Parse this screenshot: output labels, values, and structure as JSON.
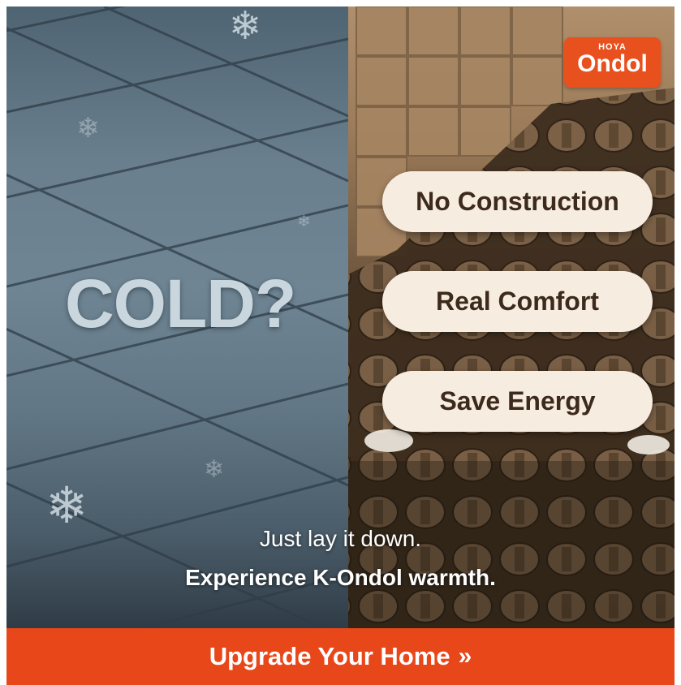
{
  "left_panel": {
    "headline": "COLD?"
  },
  "logo": {
    "small": "HOYA",
    "big": "Ondol"
  },
  "features": [
    {
      "label": "No Construction"
    },
    {
      "label": "Real Comfort"
    },
    {
      "label": "Save Energy"
    }
  ],
  "tagline": {
    "line1": "Just lay it down.",
    "line2": "Experience K-Ondol warmth."
  },
  "cta": {
    "label": "Upgrade Your Home",
    "arrow": "»"
  },
  "colors": {
    "brand_orange": "#e8471a",
    "pill_bg": "#f6ece0",
    "pill_text": "#3c2a1c"
  }
}
